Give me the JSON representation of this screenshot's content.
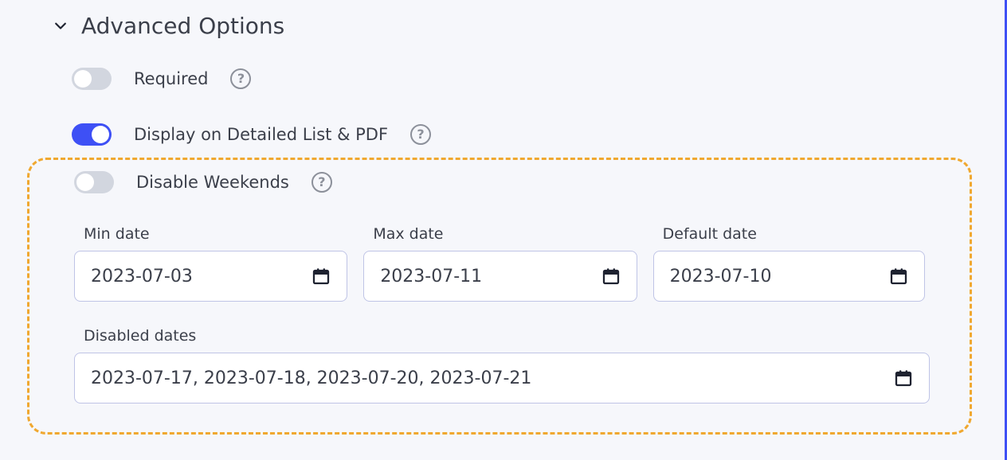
{
  "section": {
    "title": "Advanced Options"
  },
  "options": {
    "required": {
      "label": "Required",
      "on": false
    },
    "display": {
      "label": "Display on Detailed List & PDF",
      "on": true
    },
    "disable_weekends": {
      "label": "Disable Weekends",
      "on": false
    }
  },
  "fields": {
    "min_date": {
      "label": "Min date",
      "value": "2023-07-03"
    },
    "max_date": {
      "label": "Max date",
      "value": "2023-07-11"
    },
    "default_date": {
      "label": "Default date",
      "value": "2023-07-10"
    },
    "disabled_dates": {
      "label": "Disabled dates",
      "value": "2023-07-17, 2023-07-18, 2023-07-20, 2023-07-21"
    }
  }
}
